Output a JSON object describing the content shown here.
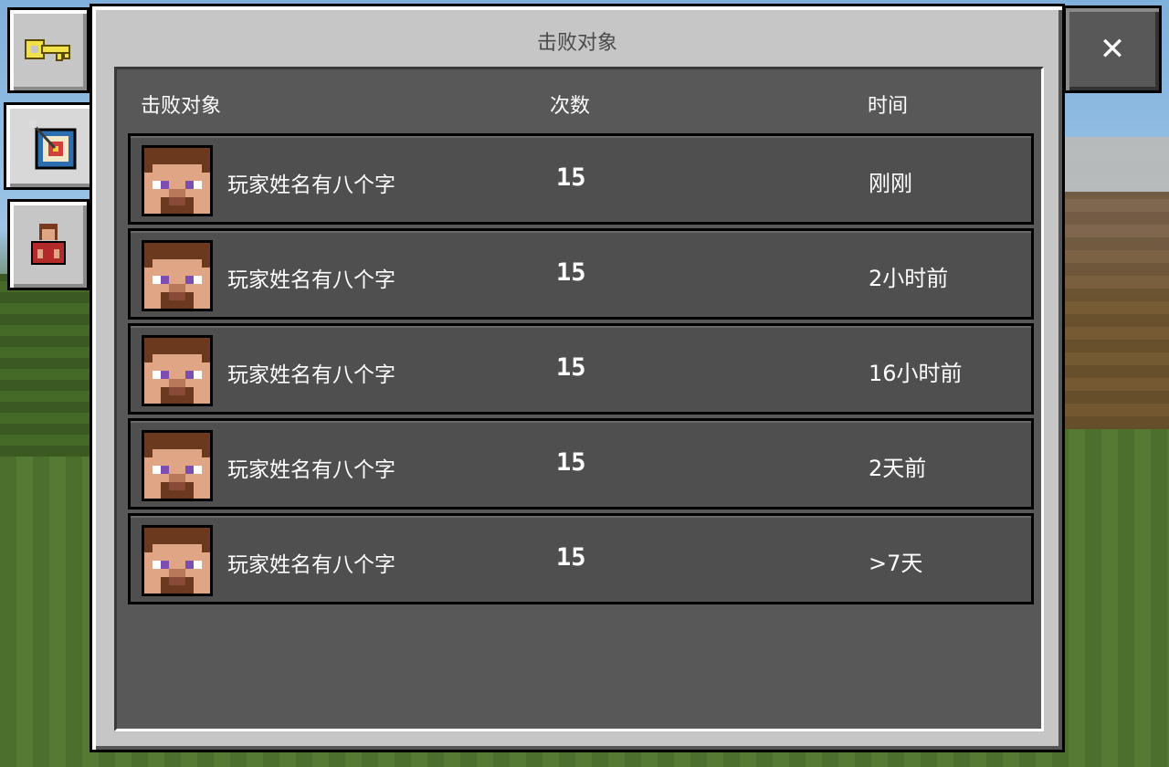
{
  "window": {
    "title": "击败对象"
  },
  "close": {
    "glyph": "✕"
  },
  "tabs": [
    {
      "icon": "key-icon"
    },
    {
      "icon": "target-icon",
      "selected": true
    },
    {
      "icon": "player-icon"
    }
  ],
  "table": {
    "headers": [
      "击败对象",
      "次数",
      "时间"
    ],
    "rows": [
      {
        "name": "玩家姓名有八个字",
        "count": "15",
        "time": "刚刚"
      },
      {
        "name": "玩家姓名有八个字",
        "count": "15",
        "time": "2小时前"
      },
      {
        "name": "玩家姓名有八个字",
        "count": "15",
        "time": "16小时前"
      },
      {
        "name": "玩家姓名有八个字",
        "count": "15",
        "time": "2天前"
      },
      {
        "name": "玩家姓名有八个字",
        "count": "15",
        "time": ">7天"
      }
    ]
  },
  "colors": {
    "panel": "#c6c6c6",
    "inner": "#585858",
    "row": "#4f4f4f"
  }
}
